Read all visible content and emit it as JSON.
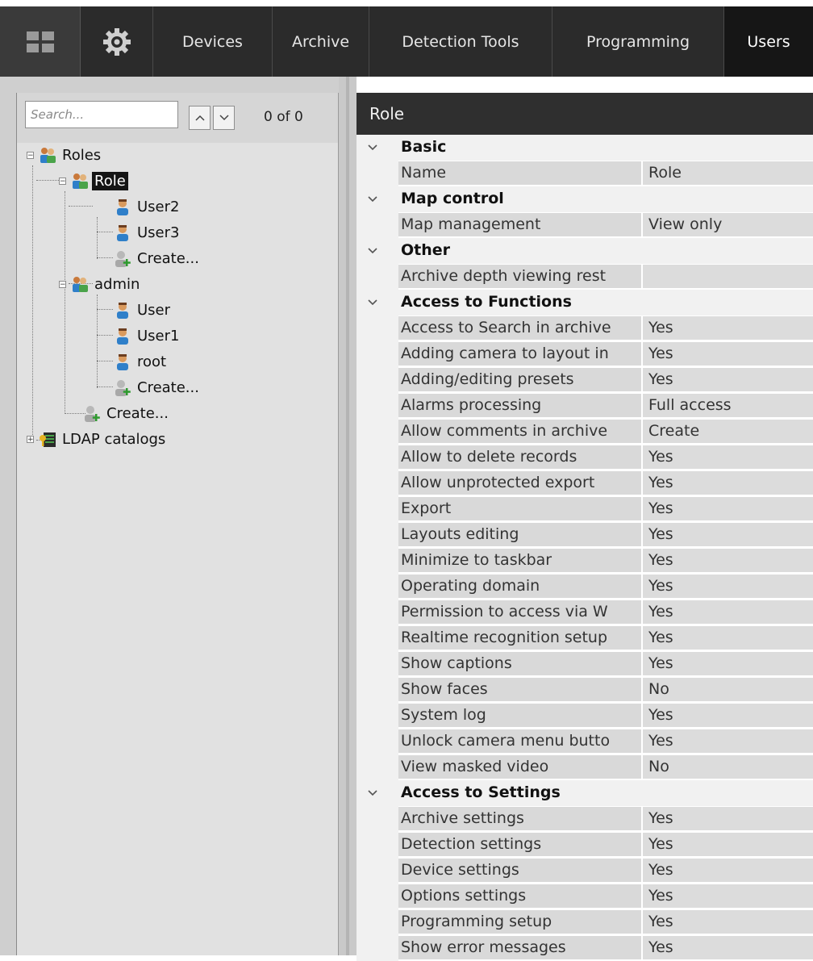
{
  "topbar": {
    "tabs": [
      {
        "label": "Devices"
      },
      {
        "label": "Archive"
      },
      {
        "label": "Detection Tools"
      },
      {
        "label": "Programming"
      },
      {
        "label": "Users"
      }
    ],
    "active_tab": "Users",
    "icons": [
      "grid-icon",
      "gear-icon"
    ]
  },
  "search": {
    "placeholder": "Search...",
    "value": "",
    "count": "0 of 0"
  },
  "tree": {
    "roles": "Roles",
    "role": "Role",
    "user2": "User2",
    "user3": "User3",
    "create1": "Create...",
    "admin": "admin",
    "user": "User",
    "user1": "User1",
    "root": "root",
    "create2": "Create...",
    "create3": "Create...",
    "ldap": "LDAP catalogs"
  },
  "properties": {
    "title": "Role",
    "rows": [
      {
        "type": "category",
        "label": "Basic"
      },
      {
        "type": "prop",
        "name": "Name",
        "value": "Role"
      },
      {
        "type": "category",
        "label": "Map control"
      },
      {
        "type": "prop",
        "name": "Map management",
        "value": "View only"
      },
      {
        "type": "category",
        "label": "Other"
      },
      {
        "type": "prop",
        "name": "Archive depth viewing rest",
        "value": ""
      },
      {
        "type": "category",
        "label": "Access to Functions"
      },
      {
        "type": "prop",
        "name": "Access to Search in archive",
        "value": "Yes"
      },
      {
        "type": "prop",
        "name": "Adding camera to layout in",
        "value": "Yes"
      },
      {
        "type": "prop",
        "name": "Adding/editing presets",
        "value": "Yes"
      },
      {
        "type": "prop",
        "name": "Alarms processing",
        "value": "Full access"
      },
      {
        "type": "prop",
        "name": "Allow comments in archive",
        "value": "Create"
      },
      {
        "type": "prop",
        "name": "Allow to delete records",
        "value": "Yes"
      },
      {
        "type": "prop",
        "name": "Allow unprotected export",
        "value": "Yes"
      },
      {
        "type": "prop",
        "name": "Export",
        "value": "Yes"
      },
      {
        "type": "prop",
        "name": "Layouts editing",
        "value": "Yes"
      },
      {
        "type": "prop",
        "name": "Minimize to taskbar",
        "value": "Yes"
      },
      {
        "type": "prop",
        "name": "Operating domain",
        "value": "Yes"
      },
      {
        "type": "prop",
        "name": "Permission to access via W",
        "value": "Yes"
      },
      {
        "type": "prop",
        "name": "Realtime recognition setup",
        "value": "Yes"
      },
      {
        "type": "prop",
        "name": "Show captions",
        "value": "Yes"
      },
      {
        "type": "prop",
        "name": "Show faces",
        "value": "No"
      },
      {
        "type": "prop",
        "name": "System log",
        "value": "Yes"
      },
      {
        "type": "prop",
        "name": "Unlock camera menu butto",
        "value": "Yes"
      },
      {
        "type": "prop",
        "name": "View masked video",
        "value": "No"
      },
      {
        "type": "category",
        "label": "Access to Settings"
      },
      {
        "type": "prop",
        "name": "Archive settings",
        "value": "Yes"
      },
      {
        "type": "prop",
        "name": "Detection settings",
        "value": "Yes"
      },
      {
        "type": "prop",
        "name": "Device settings",
        "value": "Yes"
      },
      {
        "type": "prop",
        "name": "Options settings",
        "value": "Yes"
      },
      {
        "type": "prop",
        "name": "Programming setup",
        "value": "Yes"
      },
      {
        "type": "prop",
        "name": "Show error messages",
        "value": "Yes"
      }
    ]
  }
}
